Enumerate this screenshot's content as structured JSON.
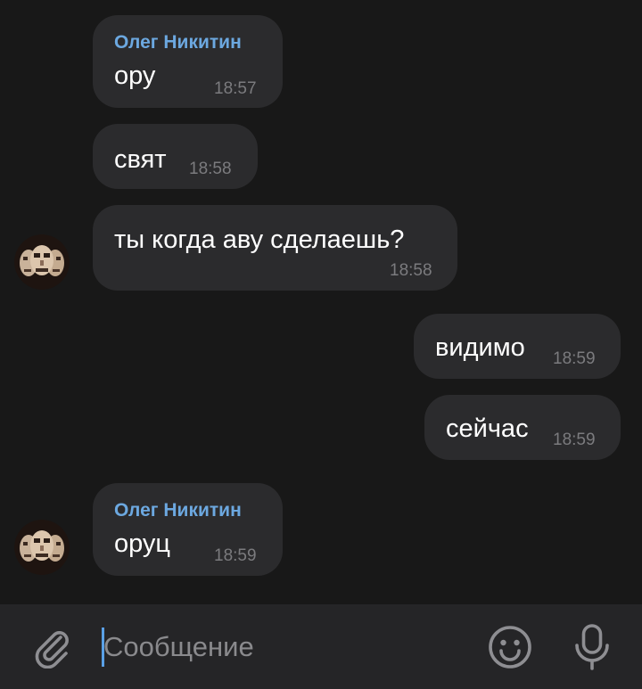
{
  "messages": [
    {
      "sender": "Олег Никитин",
      "text": "ору",
      "time": "18:57"
    },
    {
      "text": "свят",
      "time": "18:58"
    },
    {
      "text": "ты когда аву сделаешь?",
      "time": "18:58"
    },
    {
      "text": "видимо",
      "time": "18:59"
    },
    {
      "text": "сейчас",
      "time": "18:59"
    },
    {
      "sender": "Олег Никитин",
      "text": "оруц",
      "time": "18:59"
    }
  ],
  "composer": {
    "placeholder": "Сообщение"
  },
  "icons": {
    "attach": "paperclip-icon",
    "emoji": "smiley-icon",
    "mic": "microphone-icon"
  },
  "colors": {
    "background": "#181818",
    "bubble": "#2b2b2d",
    "sender_name": "#6ca8e0",
    "caret": "#5aa0e6"
  }
}
